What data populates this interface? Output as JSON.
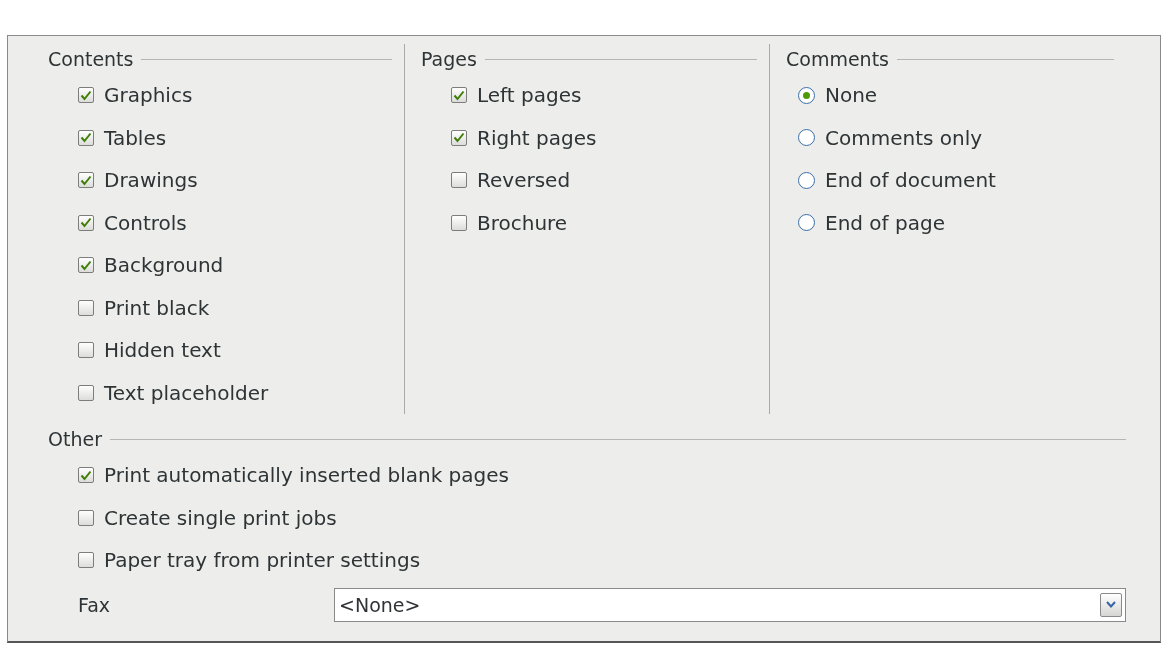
{
  "groups": [
    {
      "title": "Contents",
      "kind": "checkbox",
      "items": [
        {
          "label": "Graphics",
          "checked": true
        },
        {
          "label": "Tables",
          "checked": true
        },
        {
          "label": "Drawings",
          "checked": true
        },
        {
          "label": "Controls",
          "checked": true
        },
        {
          "label": "Background",
          "checked": true
        },
        {
          "label": "Print black",
          "checked": false
        },
        {
          "label": "Hidden text",
          "checked": false
        },
        {
          "label": "Text placeholder",
          "checked": false
        }
      ]
    },
    {
      "title": "Pages",
      "kind": "checkbox",
      "items": [
        {
          "label": "Left pages",
          "checked": true
        },
        {
          "label": "Right pages",
          "checked": true
        },
        {
          "label": "Reversed",
          "checked": false
        },
        {
          "label": "Brochure",
          "checked": false
        }
      ]
    },
    {
      "title": "Comments",
      "kind": "radio",
      "items": [
        {
          "label": "None",
          "selected": true
        },
        {
          "label": "Comments only",
          "selected": false
        },
        {
          "label": "End of document",
          "selected": false
        },
        {
          "label": "End of page",
          "selected": false
        }
      ]
    }
  ],
  "other": {
    "title": "Other",
    "items": [
      {
        "label": "Print automatically inserted blank pages",
        "checked": true
      },
      {
        "label": "Create single print jobs",
        "checked": false
      },
      {
        "label": "Paper tray from printer settings",
        "checked": false
      }
    ],
    "fax": {
      "label": "Fax",
      "value": "<None>"
    }
  }
}
